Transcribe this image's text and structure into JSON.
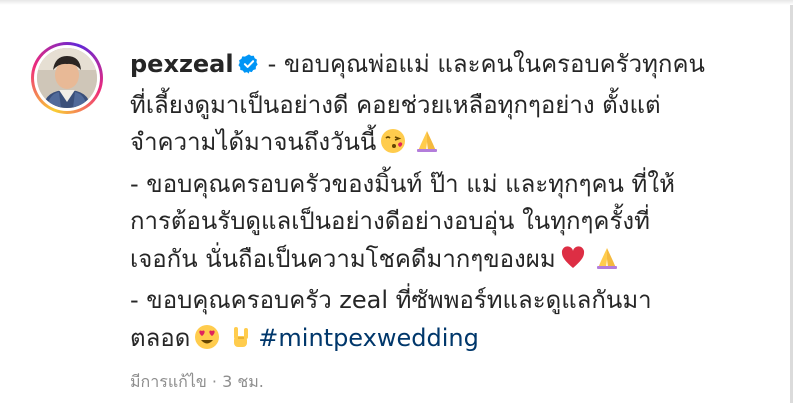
{
  "post": {
    "username": "pexzeal",
    "caption_lines": [
      "- ขอบคุณพ่อแม่ และคนในครอบครัวทุกคน",
      "ที่เลี้ยงดูมาเป็นอย่างดี คอยช่วยเหลือทุกๆอย่าง ตั้งแต่",
      "จำความได้มาจนถึงวันนี้",
      "- ขอบคุณครอบครัวของมิ้นท์ ป๊า แม่ และทุกๆคน ที่ให้",
      "การต้อนรับดูแลเป็นอย่างดีอย่างอบอุ่น ในทุกๆครั้งที่",
      "เจอกัน นั่นถือเป็นความโชคดีมากๆของผม",
      "- ขอบคุณครอบครัว zeal ที่ซัพพอร์ทและดูแลกันมา",
      "ตลอด"
    ],
    "hashtag": "#mintpexwedding",
    "edited_label": "มีการแก้ไข",
    "separator": "·",
    "time_ago": "3 ชม."
  },
  "icons": {
    "verified": "verified-badge-icon",
    "kiss": "face-blowing-kiss-emoji",
    "pray": "folded-hands-emoji",
    "heart": "red-heart-emoji",
    "heart_eyes": "heart-eyes-emoji",
    "rock": "sign-of-horns-emoji"
  },
  "colors": {
    "text": "#262626",
    "hashtag": "#00376b",
    "verified": "#0095f6",
    "meta": "#8e8e8e"
  }
}
